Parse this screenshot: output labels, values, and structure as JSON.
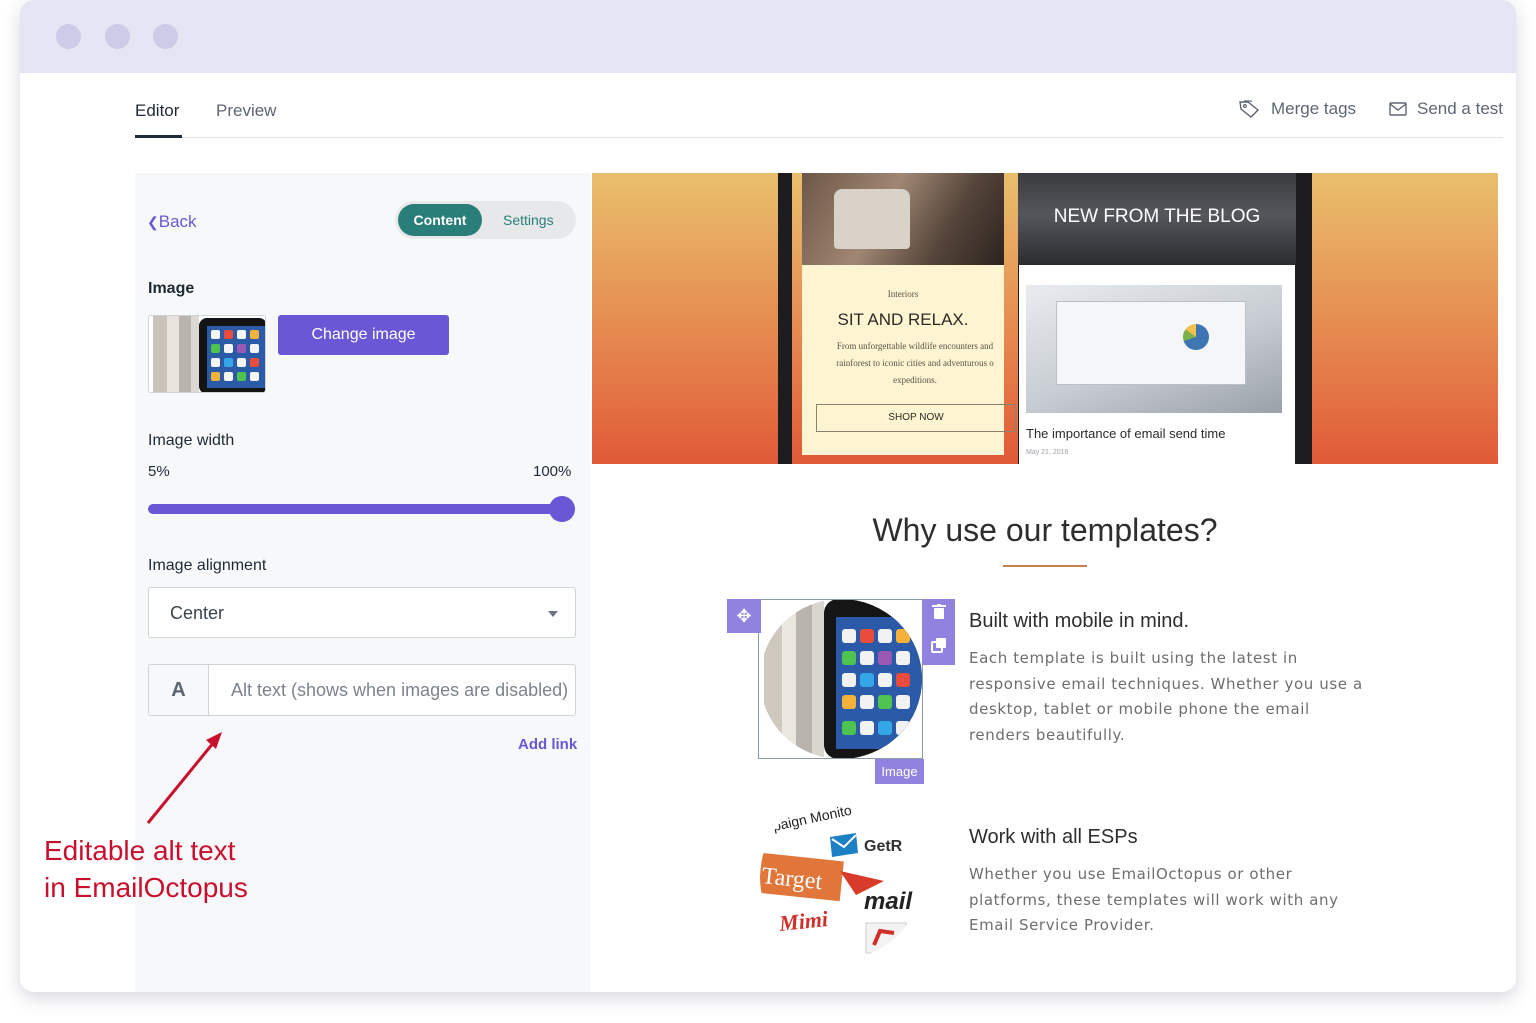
{
  "window": {
    "title_dots": [
      "close",
      "minimize",
      "maximize"
    ]
  },
  "nav": {
    "tabs": [
      {
        "label": "Editor",
        "active": true
      },
      {
        "label": "Preview",
        "active": false
      }
    ],
    "actions": [
      {
        "label": "Merge tags",
        "icon": "tag-icon"
      },
      {
        "label": "Send a test",
        "icon": "envelope-icon"
      }
    ]
  },
  "sidebar": {
    "back_label": "Back",
    "toggle": {
      "active": "Content",
      "inactive": "Settings"
    },
    "image_section_label": "Image",
    "change_image_label": "Change image",
    "image_width": {
      "label": "Image width",
      "min_label": "5%",
      "max_label": "100%",
      "value_percent": 100
    },
    "image_alignment": {
      "label": "Image alignment",
      "selected": "Center"
    },
    "alt_text": {
      "prefix": "A",
      "placeholder": "Alt text (shows when images are disabled)",
      "value": ""
    },
    "add_link_label": "Add link"
  },
  "email": {
    "hero": {
      "card_kicker": "Interiors",
      "card_title": "SIT AND RELAX.",
      "card_text": "From unforgettable wildlife encounters and rainforest to iconic cities and adventurous o expeditions.",
      "card_button": "SHOP NOW",
      "blog_heading": "NEW FROM THE BLOG",
      "blog_caption": "The importance of email send time",
      "blog_date": "May 21, 2016"
    },
    "section_title": "Why use our templates?",
    "features": [
      {
        "title": "Built with mobile in mind.",
        "text": "Each template is built using the latest in responsive email techniques. Whether you use a desktop, tablet or mobile phone the email renders beautifully."
      },
      {
        "title": "Work with all ESPs",
        "text": "Whether you use EmailOctopus or other platforms, these templates will work with any Email Service Provider."
      }
    ],
    "selected_block_tag": "Image",
    "esp_logo_words": [
      "paign Monito",
      "GetR",
      "Target",
      "mail",
      "Mimi"
    ]
  },
  "annotation": {
    "line1": "Editable alt text",
    "line2": "in EmailOctopus",
    "color": "#c8102e"
  },
  "colors": {
    "accent": "#6a57d5",
    "teal": "#2a7e7a",
    "selection": "#9182e0"
  }
}
